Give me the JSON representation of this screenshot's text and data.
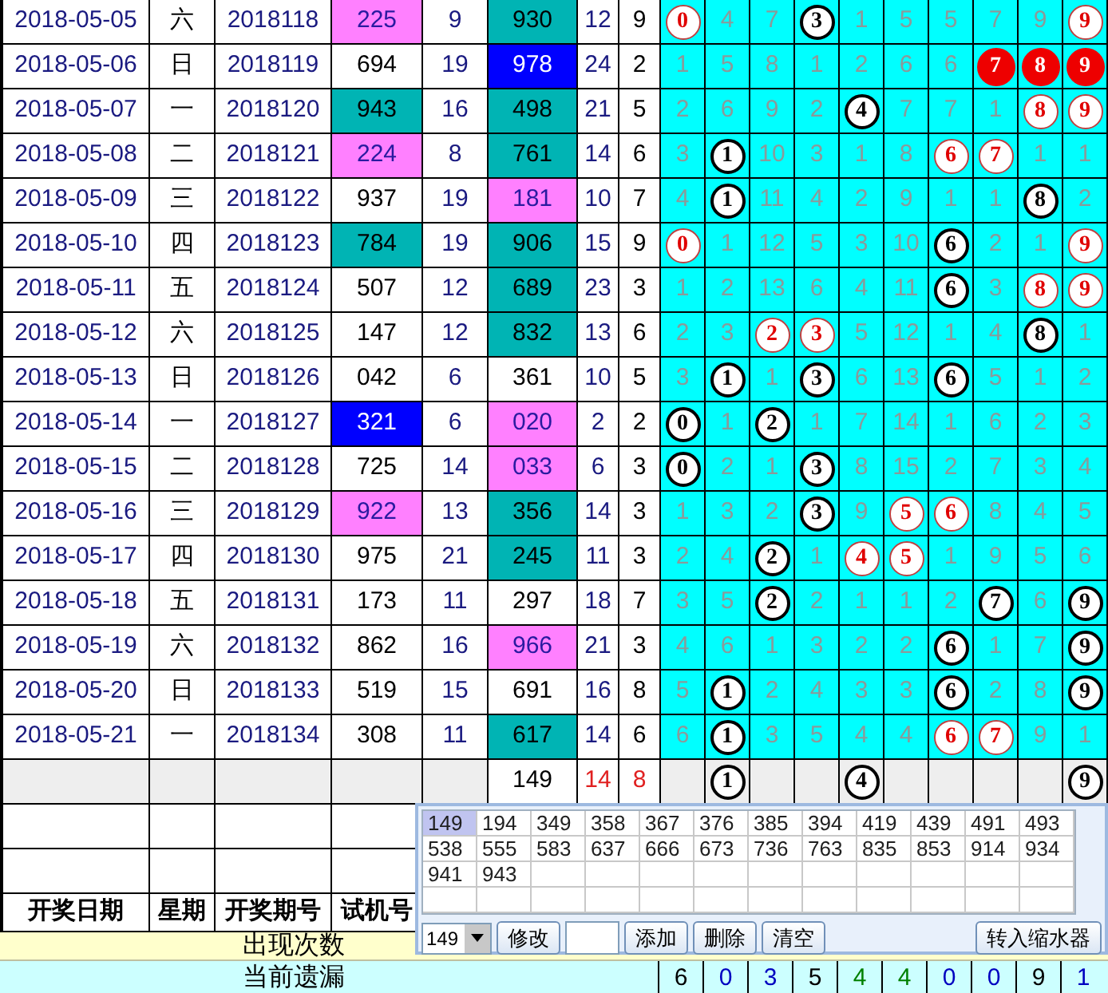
{
  "rows": [
    {
      "kind": "draw",
      "date": "2018-05-05",
      "weekday": "六",
      "period": "2018118",
      "test": {
        "text": "225",
        "color": "#ff80ff"
      },
      "column_5": "9",
      "column_6": {
        "text": "930",
        "color": "#00b4b4"
      },
      "column_7": "12",
      "column_8": "9",
      "digits": [
        {
          "kind": "hot",
          "text": "0"
        },
        {
          "kind": "miss",
          "text": "4"
        },
        {
          "kind": "miss",
          "text": "7"
        },
        {
          "kind": "ball",
          "text": "3"
        },
        {
          "kind": "miss",
          "text": "1"
        },
        {
          "kind": "miss",
          "text": "5"
        },
        {
          "kind": "miss",
          "text": "5"
        },
        {
          "kind": "miss",
          "text": "7"
        },
        {
          "kind": "miss",
          "text": "9"
        },
        {
          "kind": "hot",
          "text": "9"
        }
      ]
    },
    {
      "kind": "draw",
      "date": "2018-05-06",
      "weekday": "日",
      "period": "2018119",
      "test": {
        "text": "694",
        "color": "#ffffff"
      },
      "column_5": "19",
      "column_6": {
        "text": "978",
        "color": "#0000ff"
      },
      "column_7": "24",
      "column_8": "2",
      "digits": [
        {
          "kind": "miss",
          "text": "1"
        },
        {
          "kind": "miss",
          "text": "5"
        },
        {
          "kind": "miss",
          "text": "8"
        },
        {
          "kind": "miss",
          "text": "1"
        },
        {
          "kind": "miss",
          "text": "2"
        },
        {
          "kind": "miss",
          "text": "6"
        },
        {
          "kind": "miss",
          "text": "6"
        },
        {
          "kind": "red",
          "text": "7"
        },
        {
          "kind": "red",
          "text": "8"
        },
        {
          "kind": "red",
          "text": "9"
        }
      ]
    },
    {
      "kind": "draw",
      "date": "2018-05-07",
      "weekday": "一",
      "period": "2018120",
      "test": {
        "text": "943",
        "color": "#00b4b4"
      },
      "column_5": "16",
      "column_6": {
        "text": "498",
        "color": "#00b4b4"
      },
      "column_7": "21",
      "column_8": "5",
      "digits": [
        {
          "kind": "miss",
          "text": "2"
        },
        {
          "kind": "miss",
          "text": "6"
        },
        {
          "kind": "miss",
          "text": "9"
        },
        {
          "kind": "miss",
          "text": "2"
        },
        {
          "kind": "ball",
          "text": "4"
        },
        {
          "kind": "miss",
          "text": "7"
        },
        {
          "kind": "miss",
          "text": "7"
        },
        {
          "kind": "miss",
          "text": "1"
        },
        {
          "kind": "hot",
          "text": "8"
        },
        {
          "kind": "hot",
          "text": "9"
        }
      ]
    },
    {
      "kind": "draw",
      "date": "2018-05-08",
      "weekday": "二",
      "period": "2018121",
      "test": {
        "text": "224",
        "color": "#ff80ff"
      },
      "column_5": "8",
      "column_6": {
        "text": "761",
        "color": "#00b4b4"
      },
      "column_7": "14",
      "column_8": "6",
      "digits": [
        {
          "kind": "miss",
          "text": "3"
        },
        {
          "kind": "ball",
          "text": "1"
        },
        {
          "kind": "miss",
          "text": "10"
        },
        {
          "kind": "miss",
          "text": "3"
        },
        {
          "kind": "miss",
          "text": "1"
        },
        {
          "kind": "miss",
          "text": "8"
        },
        {
          "kind": "hot",
          "text": "6"
        },
        {
          "kind": "hot",
          "text": "7"
        },
        {
          "kind": "miss",
          "text": "1"
        },
        {
          "kind": "miss",
          "text": "1"
        }
      ]
    },
    {
      "kind": "draw",
      "date": "2018-05-09",
      "weekday": "三",
      "period": "2018122",
      "test": {
        "text": "937",
        "color": "#ffffff"
      },
      "column_5": "19",
      "column_6": {
        "text": "181",
        "color": "#ff80ff"
      },
      "column_7": "10",
      "column_8": "7",
      "digits": [
        {
          "kind": "miss",
          "text": "4"
        },
        {
          "kind": "ball",
          "text": "1"
        },
        {
          "kind": "miss",
          "text": "11"
        },
        {
          "kind": "miss",
          "text": "4"
        },
        {
          "kind": "miss",
          "text": "2"
        },
        {
          "kind": "miss",
          "text": "9"
        },
        {
          "kind": "miss",
          "text": "1"
        },
        {
          "kind": "miss",
          "text": "1"
        },
        {
          "kind": "ball",
          "text": "8"
        },
        {
          "kind": "miss",
          "text": "2"
        }
      ]
    },
    {
      "kind": "draw",
      "date": "2018-05-10",
      "weekday": "四",
      "period": "2018123",
      "test": {
        "text": "784",
        "color": "#00b4b4"
      },
      "column_5": "19",
      "column_6": {
        "text": "906",
        "color": "#00b4b4"
      },
      "column_7": "15",
      "column_8": "9",
      "digits": [
        {
          "kind": "hot",
          "text": "0"
        },
        {
          "kind": "miss",
          "text": "1"
        },
        {
          "kind": "miss",
          "text": "12"
        },
        {
          "kind": "miss",
          "text": "5"
        },
        {
          "kind": "miss",
          "text": "3"
        },
        {
          "kind": "miss",
          "text": "10"
        },
        {
          "kind": "ball",
          "text": "6"
        },
        {
          "kind": "miss",
          "text": "2"
        },
        {
          "kind": "miss",
          "text": "1"
        },
        {
          "kind": "hot",
          "text": "9"
        }
      ]
    },
    {
      "kind": "draw",
      "date": "2018-05-11",
      "weekday": "五",
      "period": "2018124",
      "test": {
        "text": "507",
        "color": "#ffffff"
      },
      "column_5": "12",
      "column_6": {
        "text": "689",
        "color": "#00b4b4"
      },
      "column_7": "23",
      "column_8": "3",
      "digits": [
        {
          "kind": "miss",
          "text": "1"
        },
        {
          "kind": "miss",
          "text": "2"
        },
        {
          "kind": "miss",
          "text": "13"
        },
        {
          "kind": "miss",
          "text": "6"
        },
        {
          "kind": "miss",
          "text": "4"
        },
        {
          "kind": "miss",
          "text": "11"
        },
        {
          "kind": "ball",
          "text": "6"
        },
        {
          "kind": "miss",
          "text": "3"
        },
        {
          "kind": "hot",
          "text": "8"
        },
        {
          "kind": "hot",
          "text": "9"
        }
      ]
    },
    {
      "kind": "draw",
      "date": "2018-05-12",
      "weekday": "六",
      "period": "2018125",
      "test": {
        "text": "147",
        "color": "#ffffff"
      },
      "column_5": "12",
      "column_6": {
        "text": "832",
        "color": "#00b4b4"
      },
      "column_7": "13",
      "column_8": "6",
      "digits": [
        {
          "kind": "miss",
          "text": "2"
        },
        {
          "kind": "miss",
          "text": "3"
        },
        {
          "kind": "hot",
          "text": "2"
        },
        {
          "kind": "hot",
          "text": "3"
        },
        {
          "kind": "miss",
          "text": "5"
        },
        {
          "kind": "miss",
          "text": "12"
        },
        {
          "kind": "miss",
          "text": "1"
        },
        {
          "kind": "miss",
          "text": "4"
        },
        {
          "kind": "ball",
          "text": "8"
        },
        {
          "kind": "miss",
          "text": "1"
        }
      ]
    },
    {
      "kind": "draw",
      "date": "2018-05-13",
      "weekday": "日",
      "period": "2018126",
      "test": {
        "text": "042",
        "color": "#ffffff"
      },
      "column_5": "6",
      "column_6": {
        "text": "361",
        "color": "#ffffff"
      },
      "column_7": "10",
      "column_8": "5",
      "digits": [
        {
          "kind": "miss",
          "text": "3"
        },
        {
          "kind": "ball",
          "text": "1"
        },
        {
          "kind": "miss",
          "text": "1"
        },
        {
          "kind": "ball",
          "text": "3"
        },
        {
          "kind": "miss",
          "text": "6"
        },
        {
          "kind": "miss",
          "text": "13"
        },
        {
          "kind": "ball",
          "text": "6"
        },
        {
          "kind": "miss",
          "text": "5"
        },
        {
          "kind": "miss",
          "text": "1"
        },
        {
          "kind": "miss",
          "text": "2"
        }
      ]
    },
    {
      "kind": "draw",
      "date": "2018-05-14",
      "weekday": "一",
      "period": "2018127",
      "test": {
        "text": "321",
        "color": "#0000ff"
      },
      "column_5": "6",
      "column_6": {
        "text": "020",
        "color": "#ff80ff"
      },
      "column_7": "2",
      "column_8": "2",
      "digits": [
        {
          "kind": "ball",
          "text": "0"
        },
        {
          "kind": "miss",
          "text": "1"
        },
        {
          "kind": "ball",
          "text": "2"
        },
        {
          "kind": "miss",
          "text": "1"
        },
        {
          "kind": "miss",
          "text": "7"
        },
        {
          "kind": "miss",
          "text": "14"
        },
        {
          "kind": "miss",
          "text": "1"
        },
        {
          "kind": "miss",
          "text": "6"
        },
        {
          "kind": "miss",
          "text": "2"
        },
        {
          "kind": "miss",
          "text": "3"
        }
      ]
    },
    {
      "kind": "draw",
      "date": "2018-05-15",
      "weekday": "二",
      "period": "2018128",
      "test": {
        "text": "725",
        "color": "#ffffff"
      },
      "column_5": "14",
      "column_6": {
        "text": "033",
        "color": "#ff80ff"
      },
      "column_7": "6",
      "column_8": "3",
      "digits": [
        {
          "kind": "ball",
          "text": "0"
        },
        {
          "kind": "miss",
          "text": "2"
        },
        {
          "kind": "miss",
          "text": "1"
        },
        {
          "kind": "ball",
          "text": "3"
        },
        {
          "kind": "miss",
          "text": "8"
        },
        {
          "kind": "miss",
          "text": "15"
        },
        {
          "kind": "miss",
          "text": "2"
        },
        {
          "kind": "miss",
          "text": "7"
        },
        {
          "kind": "miss",
          "text": "3"
        },
        {
          "kind": "miss",
          "text": "4"
        }
      ]
    },
    {
      "kind": "draw",
      "date": "2018-05-16",
      "weekday": "三",
      "period": "2018129",
      "test": {
        "text": "922",
        "color": "#ff80ff"
      },
      "column_5": "13",
      "column_6": {
        "text": "356",
        "color": "#00b4b4"
      },
      "column_7": "14",
      "column_8": "3",
      "digits": [
        {
          "kind": "miss",
          "text": "1"
        },
        {
          "kind": "miss",
          "text": "3"
        },
        {
          "kind": "miss",
          "text": "2"
        },
        {
          "kind": "ball",
          "text": "3"
        },
        {
          "kind": "miss",
          "text": "9"
        },
        {
          "kind": "hot",
          "text": "5"
        },
        {
          "kind": "hot",
          "text": "6"
        },
        {
          "kind": "miss",
          "text": "8"
        },
        {
          "kind": "miss",
          "text": "4"
        },
        {
          "kind": "miss",
          "text": "5"
        }
      ]
    },
    {
      "kind": "draw",
      "date": "2018-05-17",
      "weekday": "四",
      "period": "2018130",
      "test": {
        "text": "975",
        "color": "#ffffff"
      },
      "column_5": "21",
      "column_6": {
        "text": "245",
        "color": "#00b4b4"
      },
      "column_7": "11",
      "column_8": "3",
      "digits": [
        {
          "kind": "miss",
          "text": "2"
        },
        {
          "kind": "miss",
          "text": "4"
        },
        {
          "kind": "ball",
          "text": "2"
        },
        {
          "kind": "miss",
          "text": "1"
        },
        {
          "kind": "hot",
          "text": "4"
        },
        {
          "kind": "hot",
          "text": "5"
        },
        {
          "kind": "miss",
          "text": "1"
        },
        {
          "kind": "miss",
          "text": "9"
        },
        {
          "kind": "miss",
          "text": "5"
        },
        {
          "kind": "miss",
          "text": "6"
        }
      ]
    },
    {
      "kind": "draw",
      "date": "2018-05-18",
      "weekday": "五",
      "period": "2018131",
      "test": {
        "text": "173",
        "color": "#ffffff"
      },
      "column_5": "11",
      "column_6": {
        "text": "297",
        "color": "#ffffff"
      },
      "column_7": "18",
      "column_8": "7",
      "digits": [
        {
          "kind": "miss",
          "text": "3"
        },
        {
          "kind": "miss",
          "text": "5"
        },
        {
          "kind": "ball",
          "text": "2"
        },
        {
          "kind": "miss",
          "text": "2"
        },
        {
          "kind": "miss",
          "text": "1"
        },
        {
          "kind": "miss",
          "text": "1"
        },
        {
          "kind": "miss",
          "text": "2"
        },
        {
          "kind": "ball",
          "text": "7"
        },
        {
          "kind": "miss",
          "text": "6"
        },
        {
          "kind": "ball",
          "text": "9"
        }
      ]
    },
    {
      "kind": "draw",
      "date": "2018-05-19",
      "weekday": "六",
      "period": "2018132",
      "test": {
        "text": "862",
        "color": "#ffffff"
      },
      "column_5": "16",
      "column_6": {
        "text": "966",
        "color": "#ff80ff"
      },
      "column_7": "21",
      "column_8": "3",
      "digits": [
        {
          "kind": "miss",
          "text": "4"
        },
        {
          "kind": "miss",
          "text": "6"
        },
        {
          "kind": "miss",
          "text": "1"
        },
        {
          "kind": "miss",
          "text": "3"
        },
        {
          "kind": "miss",
          "text": "2"
        },
        {
          "kind": "miss",
          "text": "2"
        },
        {
          "kind": "ball",
          "text": "6"
        },
        {
          "kind": "miss",
          "text": "1"
        },
        {
          "kind": "miss",
          "text": "7"
        },
        {
          "kind": "ball",
          "text": "9"
        }
      ]
    },
    {
      "kind": "draw",
      "date": "2018-05-20",
      "weekday": "日",
      "period": "2018133",
      "test": {
        "text": "519",
        "color": "#ffffff"
      },
      "column_5": "15",
      "column_6": {
        "text": "691",
        "color": "#ffffff"
      },
      "column_7": "16",
      "column_8": "8",
      "digits": [
        {
          "kind": "miss",
          "text": "5"
        },
        {
          "kind": "ball",
          "text": "1"
        },
        {
          "kind": "miss",
          "text": "2"
        },
        {
          "kind": "miss",
          "text": "4"
        },
        {
          "kind": "miss",
          "text": "3"
        },
        {
          "kind": "miss",
          "text": "3"
        },
        {
          "kind": "ball",
          "text": "6"
        },
        {
          "kind": "miss",
          "text": "2"
        },
        {
          "kind": "miss",
          "text": "8"
        },
        {
          "kind": "ball",
          "text": "9"
        }
      ]
    },
    {
      "kind": "draw",
      "date": "2018-05-21",
      "weekday": "一",
      "period": "2018134",
      "test": {
        "text": "308",
        "color": "#ffffff"
      },
      "column_5": "11",
      "column_6": {
        "text": "617",
        "color": "#00b4b4"
      },
      "column_7": "14",
      "column_8": "6",
      "digits": [
        {
          "kind": "miss",
          "text": "6"
        },
        {
          "kind": "ball",
          "text": "1"
        },
        {
          "kind": "miss",
          "text": "3"
        },
        {
          "kind": "miss",
          "text": "5"
        },
        {
          "kind": "miss",
          "text": "4"
        },
        {
          "kind": "miss",
          "text": "4"
        },
        {
          "kind": "hot",
          "text": "6"
        },
        {
          "kind": "hot",
          "text": "7"
        },
        {
          "kind": "miss",
          "text": "9"
        },
        {
          "kind": "miss",
          "text": "1"
        }
      ]
    },
    {
      "kind": "total",
      "column_6": {
        "text": "149",
        "color": "#ffffff"
      },
      "column_7": "14",
      "column_8": "8",
      "digits": [
        {
          "kind": "blank"
        },
        {
          "kind": "ball",
          "text": "1"
        },
        {
          "kind": "blank"
        },
        {
          "kind": "blank"
        },
        {
          "kind": "ball",
          "text": "4"
        },
        {
          "kind": "blank"
        },
        {
          "kind": "blank"
        },
        {
          "kind": "blank"
        },
        {
          "kind": "blank"
        },
        {
          "kind": "ball",
          "text": "9"
        }
      ]
    }
  ],
  "header": [
    "开奖日期",
    "星期",
    "开奖期号",
    "试机号"
  ],
  "count_row": {
    "label": "出现次数"
  },
  "miss_row": {
    "label": "当前遗漏",
    "values": [
      {
        "text": "6",
        "color": "#000000"
      },
      {
        "text": "0",
        "color": "#0000c0"
      },
      {
        "text": "3",
        "color": "#0000c0"
      },
      {
        "text": "5",
        "color": "#000000"
      },
      {
        "text": "4",
        "color": "#008000"
      },
      {
        "text": "4",
        "color": "#008000"
      },
      {
        "text": "0",
        "color": "#0000c0"
      },
      {
        "text": "0",
        "color": "#0000c0"
      },
      {
        "text": "9",
        "color": "#000000"
      },
      {
        "text": "1",
        "color": "#0000c0"
      }
    ]
  },
  "popup": {
    "numbers": [
      {
        "text": "149",
        "selected": true
      },
      {
        "text": "194",
        "selected": false
      },
      {
        "text": "349",
        "selected": false
      },
      {
        "text": "358",
        "selected": false
      },
      {
        "text": "367",
        "selected": false
      },
      {
        "text": "376",
        "selected": false
      },
      {
        "text": "385",
        "selected": false
      },
      {
        "text": "394",
        "selected": false
      },
      {
        "text": "419",
        "selected": false
      },
      {
        "text": "439",
        "selected": false
      },
      {
        "text": "491",
        "selected": false
      },
      {
        "text": "493",
        "selected": false
      },
      {
        "text": "538",
        "selected": false
      },
      {
        "text": "555",
        "selected": false
      },
      {
        "text": "583",
        "selected": false
      },
      {
        "text": "637",
        "selected": false
      },
      {
        "text": "666",
        "selected": false
      },
      {
        "text": "673",
        "selected": false
      },
      {
        "text": "736",
        "selected": false
      },
      {
        "text": "763",
        "selected": false
      },
      {
        "text": "835",
        "selected": false
      },
      {
        "text": "853",
        "selected": false
      },
      {
        "text": "914",
        "selected": false
      },
      {
        "text": "934",
        "selected": false
      },
      {
        "text": "941",
        "selected": false
      },
      {
        "text": "943",
        "selected": false
      }
    ],
    "combo": "149",
    "edit_button": "修改",
    "buttons": [
      "添加",
      "删除",
      "清空"
    ],
    "transfer_button": "转入缩水器"
  }
}
